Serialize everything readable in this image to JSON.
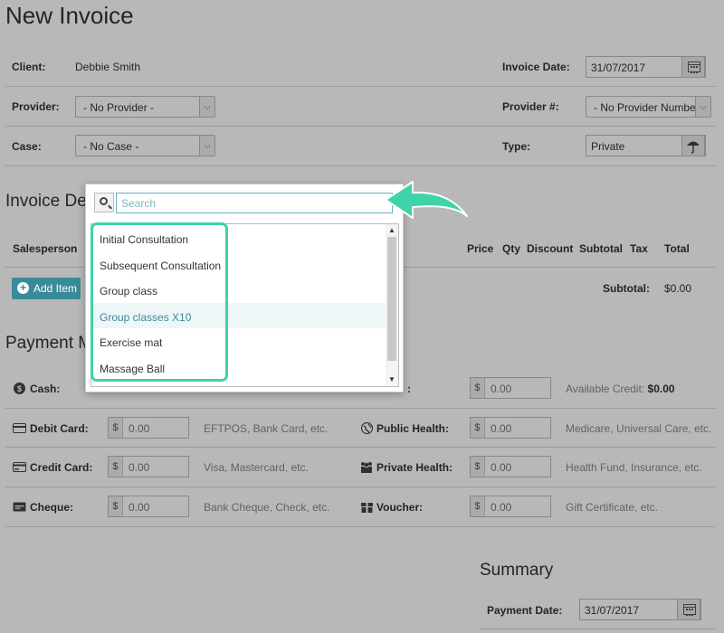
{
  "page": {
    "title": "New Invoice"
  },
  "header": {
    "client_label": "Client:",
    "client_value": "Debbie Smith",
    "invoice_date_label": "Invoice Date:",
    "invoice_date_value": "31/07/2017",
    "provider_label": "Provider:",
    "provider_value": "- No Provider -",
    "provider_num_label": "Provider #:",
    "provider_num_value": "- No Provider Numbe",
    "case_label": "Case:",
    "case_value": "- No Case -",
    "type_label": "Type:",
    "type_value": "Private"
  },
  "invoice_details": {
    "heading_visible": "Invoice De",
    "columns": {
      "salesperson": "Salesperson",
      "price": "Price",
      "qty": "Qty",
      "discount": "Discount",
      "subtotal": "Subtotal",
      "tax": "Tax",
      "total": "Total"
    },
    "add_item_label": "Add Item",
    "subtotal_label": "Subtotal:",
    "subtotal_value": "$0.00"
  },
  "payment": {
    "heading_visible": "Payment M",
    "currency_symbol": "$",
    "cash_label": "Cash:",
    "credit_label_visible": ":",
    "credit_amount": "0.00",
    "available_credit_label": "Available Credit:",
    "available_credit_value": "$0.00",
    "rows": [
      {
        "left_label": "Debit Card:",
        "left_amount": "0.00",
        "left_hint": "EFTPOS, Bank Card, etc.",
        "right_label": "Public Health:",
        "right_amount": "0.00",
        "right_hint": "Medicare, Universal Care, etc."
      },
      {
        "left_label": "Credit Card:",
        "left_amount": "0.00",
        "left_hint": "Visa, Mastercard, etc.",
        "right_label": "Private Health:",
        "right_amount": "0.00",
        "right_hint": "Health Fund, Insurance, etc."
      },
      {
        "left_label": "Cheque:",
        "left_amount": "0.00",
        "left_hint": "Bank Cheque, Check, etc.",
        "right_label": "Voucher:",
        "right_amount": "0.00",
        "right_hint": "Gift Certificate, etc."
      }
    ]
  },
  "summary": {
    "heading": "Summary",
    "payment_date_label": "Payment Date:",
    "payment_date_value": "31/07/2017"
  },
  "dropdown": {
    "search_placeholder": "Search",
    "items": [
      "Initial Consultation",
      "Subsequent Consultation",
      "Group class",
      "Group classes X10",
      "Exercise mat",
      "Massage Ball"
    ],
    "highlighted_item": "Group classes X10"
  },
  "colors": {
    "annotation": "#3ed3a9",
    "accent": "#3a8b98",
    "overlay": "rgba(0,0,0,0.28)"
  },
  "icons": {
    "calendar": "calendar-icon",
    "umbrella": "umbrella-icon",
    "search": "search-icon",
    "plus": "plus-circle-icon",
    "cash": "dollar-circle-icon",
    "debit": "card-icon",
    "credit": "credit-card-icon",
    "cheque": "cheque-icon",
    "public_health": "globe-icon",
    "private_health": "people-icon",
    "voucher": "voucher-icon",
    "arrow": "annotation-arrow"
  }
}
